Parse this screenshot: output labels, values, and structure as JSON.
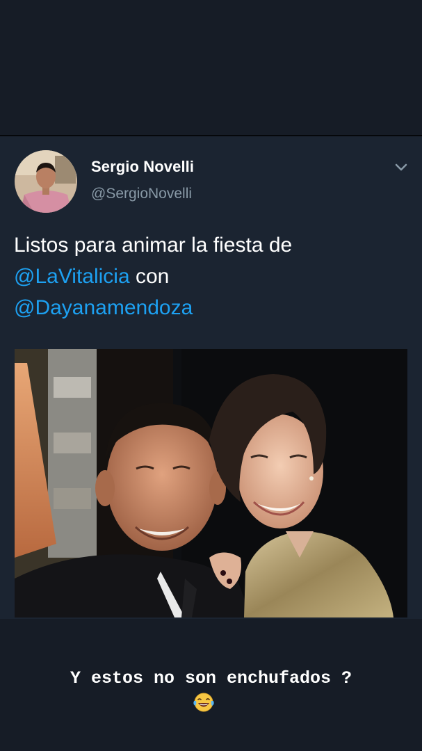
{
  "tweet": {
    "display_name": "Sergio Novelli",
    "handle": "@SergioNovelli",
    "text_line_1": "Listos para animar la fiesta de",
    "mention_1": "@LaVitalicia",
    "text_connector": " con",
    "mention_2": "@Dayanamendoza",
    "menu_icon": "chevron-down-icon"
  },
  "story": {
    "caption": "Y estos no son enchufados ?",
    "emoji": "face-with-tears-of-joy"
  },
  "colors": {
    "background": "#161c26",
    "card": "#1b2431",
    "text_primary": "#ffffff",
    "text_secondary": "#8899a6",
    "link": "#1da1f2"
  }
}
